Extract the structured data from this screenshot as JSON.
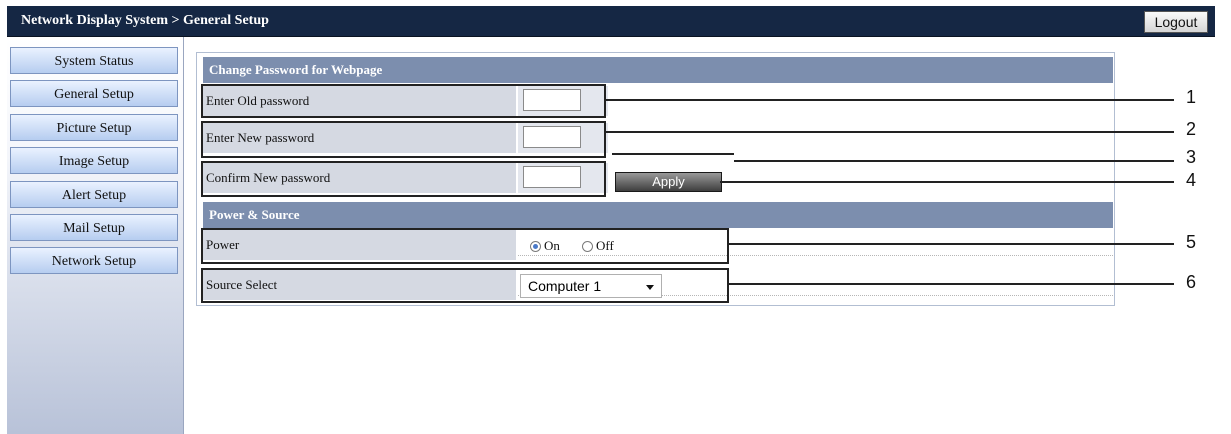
{
  "header": {
    "breadcrumb": "Network Display System > General Setup",
    "logout_label": "Logout"
  },
  "sidebar": {
    "items": [
      {
        "label": "System Status"
      },
      {
        "label": "General Setup"
      },
      {
        "label": "Picture Setup"
      },
      {
        "label": "Image Setup"
      },
      {
        "label": "Alert Setup"
      },
      {
        "label": "Mail Setup"
      },
      {
        "label": "Network Setup"
      }
    ]
  },
  "password_section": {
    "title": "Change Password for Webpage",
    "old_label": "Enter Old password",
    "new_label": "Enter New password",
    "confirm_label": "Confirm New password",
    "apply_label": "Apply"
  },
  "power_section": {
    "title": "Power & Source",
    "power_label": "Power",
    "power_on_label": "On",
    "power_off_label": "Off",
    "power_selected": "On",
    "source_label": "Source Select",
    "source_value": "Computer 1"
  },
  "callouts": [
    "1",
    "2",
    "3",
    "4",
    "5",
    "6"
  ],
  "colors": {
    "topbar": "#152744",
    "section_header": "#7c8eae",
    "label_cell": "#d5d9e2",
    "nav_button": "#b6cdf0"
  }
}
